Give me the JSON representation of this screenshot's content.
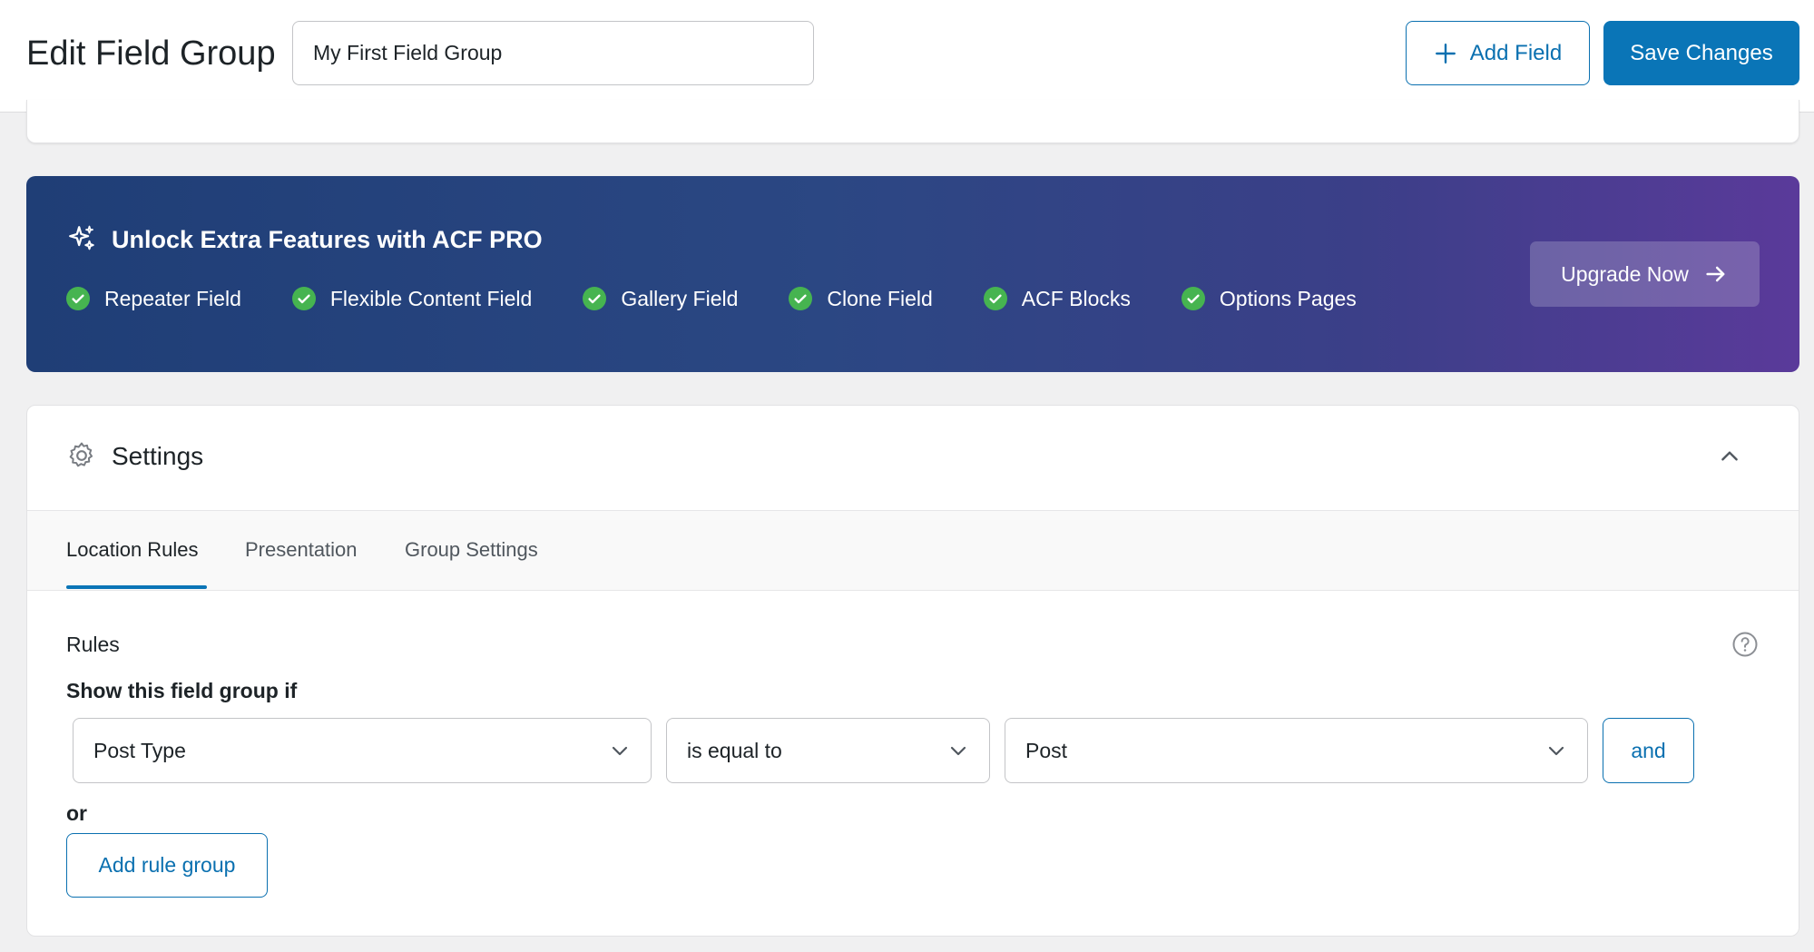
{
  "header": {
    "page_title": "Edit Field Group",
    "field_group_title": "My First Field Group",
    "add_field_label": "Add Field",
    "save_label": "Save Changes"
  },
  "promo": {
    "title": "Unlock Extra Features with ACF PRO",
    "features": [
      "Repeater Field",
      "Flexible Content Field",
      "Gallery Field",
      "Clone Field",
      "ACF Blocks",
      "Options Pages"
    ],
    "upgrade_label": "Upgrade Now"
  },
  "settings": {
    "title": "Settings",
    "tabs": [
      "Location Rules",
      "Presentation",
      "Group Settings"
    ],
    "active_tab": "Location Rules",
    "rules_label": "Rules",
    "show_label": "Show this field group if",
    "rule": {
      "param": "Post Type",
      "operator": "is equal to",
      "value": "Post",
      "and_label": "and"
    },
    "or_label": "or",
    "add_rule_group_label": "Add rule group"
  },
  "colors": {
    "accent": "#0a75b7",
    "check_green": "#46b450",
    "promo_start": "#1f3e76",
    "promo_end": "#5a3a9a"
  },
  "icons": {
    "add_field": "plus-icon",
    "promo": "sparkles-icon",
    "feature": "check-circle-icon",
    "upgrade": "arrow-right-icon",
    "settings": "gear-icon",
    "collapse": "chevron-up-icon",
    "help": "help-circle-icon",
    "select": "chevron-down-icon"
  }
}
